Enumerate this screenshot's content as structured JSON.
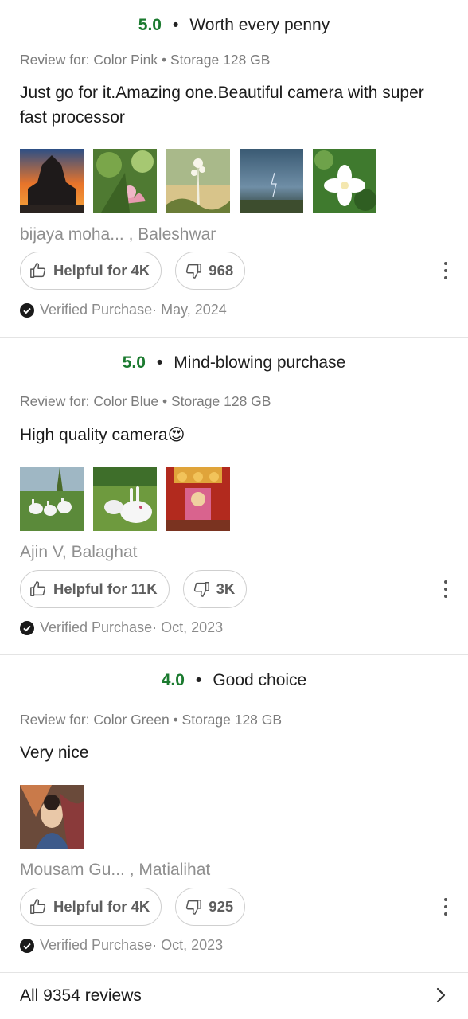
{
  "reviews": [
    {
      "rating": "5.0",
      "title": "Worth every penny",
      "variant": "Review for: Color Pink • Storage 128 GB",
      "body": "Just go for it.Amazing one.Beautiful camera with super fast processor",
      "photos": [
        "temple-sunset-photo",
        "pink-flower-photo",
        "plant-sunny-photo",
        "storm-sky-photo",
        "white-flower-photo"
      ],
      "author": "bijaya moha... , Baleshwar",
      "helpful": "Helpful for 4K",
      "dislikes": "968",
      "verified": "Verified Purchase· May, 2024"
    },
    {
      "rating": "5.0",
      "title": "Mind-blowing purchase",
      "variant": "Review for: Color Blue • Storage 128 GB",
      "body": "High quality camera😍",
      "photos": [
        "white-rabbits-photo",
        "rabbit-closeup-photo",
        "festival-shrine-photo"
      ],
      "author": "Ajin V, Balaghat",
      "helpful": "Helpful for 11K",
      "dislikes": "3K",
      "verified": "Verified Purchase· Oct, 2023"
    },
    {
      "rating": "4.0",
      "title": "Good choice",
      "variant": "Review for: Color Green • Storage 128 GB",
      "body": "Very nice",
      "photos": [
        "painting-photo"
      ],
      "author": "Mousam Gu... , Matialihat",
      "helpful": "Helpful for 4K",
      "dislikes": "925",
      "verified": "Verified Purchase· Oct, 2023"
    }
  ],
  "footer": {
    "all_reviews_label": "All 9354 reviews",
    "icon": "chevron-right-icon"
  },
  "colors": {
    "rating_green": "#1b7a2f",
    "muted_text": "#7c7c7c"
  }
}
